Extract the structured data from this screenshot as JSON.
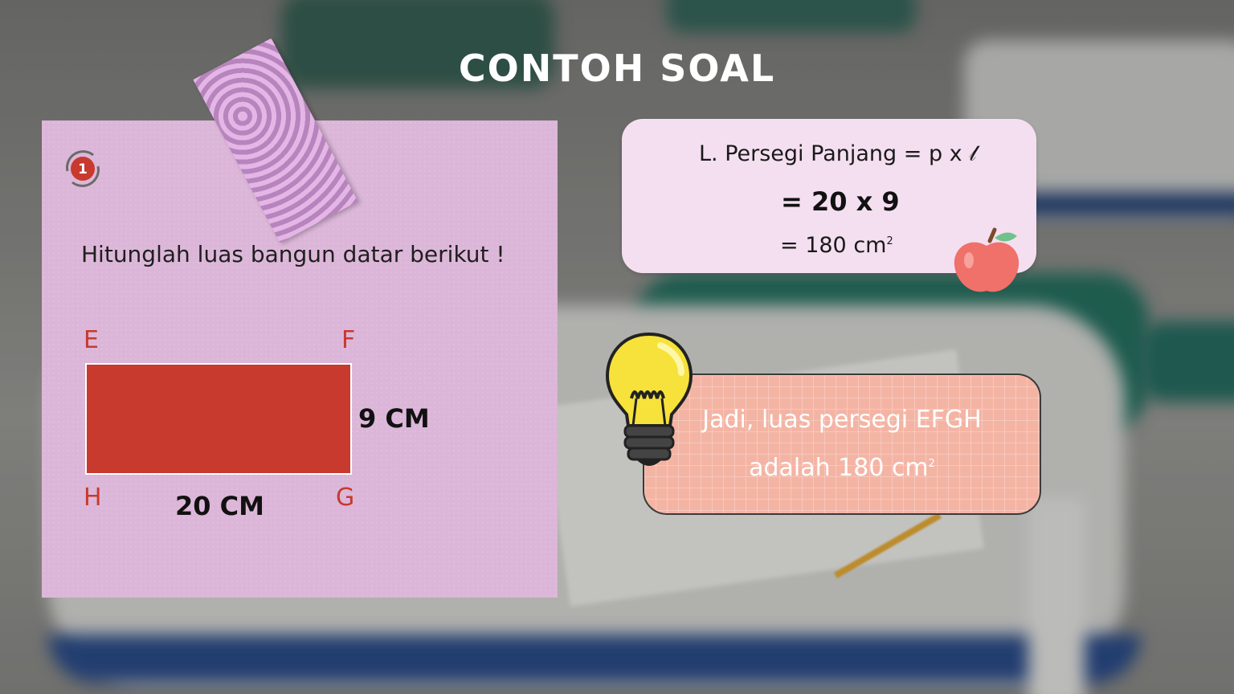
{
  "title": "CONTOH SOAL",
  "question_card": {
    "number": "1",
    "question": "Hitunglah luas bangun datar berikut !",
    "vertices": {
      "top_left": "E",
      "top_right": "F",
      "bottom_left": "H",
      "bottom_right": "G"
    },
    "height_label": "9 CM",
    "width_label": "20 CM",
    "shape_color": "#c8392e",
    "card_color": "#dcb6d8"
  },
  "formula": {
    "line1": "L. Persegi Panjang = p x  𝓁",
    "line2": "= 20 x 9",
    "line3_prefix": "= 180 cm",
    "line3_sup": "2",
    "box_color": "#f4dff0"
  },
  "conclusion": {
    "line1": "Jadi, luas persegi EFGH",
    "line2_prefix": "adalah 180 cm",
    "line2_sup": "2",
    "box_color": "#f4b4a4"
  },
  "decorations": {
    "icons": [
      "number-badge-icon",
      "apple-icon",
      "lightbulb-icon",
      "washi-tape"
    ]
  }
}
